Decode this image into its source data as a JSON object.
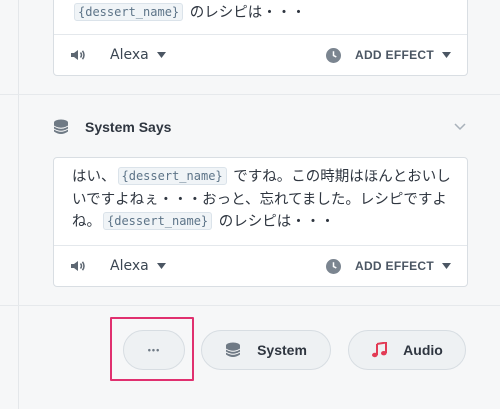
{
  "top_card": {
    "text_before": "",
    "variable": "{dessert_name}",
    "text_after": " のレシピは・・・",
    "voice": "Alexa",
    "effect_label": "ADD EFFECT"
  },
  "section": {
    "title": "System Says",
    "icon": "database-icon",
    "collapse_icon": "chevron-down-icon"
  },
  "main_card": {
    "text_1": "はい、",
    "variable_1": "{dessert_name}",
    "text_2": " ですね。この時期はほんとおいしいですよねぇ・・・おっと、忘れてました。レシピですよね。",
    "variable_2": "{dessert_name}",
    "text_3": " のレシピは・・・",
    "voice": "Alexa",
    "effect_label": "ADD EFFECT"
  },
  "buttons": {
    "more_label": "•••",
    "system_label": "System",
    "audio_label": "Audio"
  },
  "colors": {
    "highlight": "#e0306f",
    "audio_icon": "#e23b55",
    "icon_gray": "#6f7a85"
  }
}
